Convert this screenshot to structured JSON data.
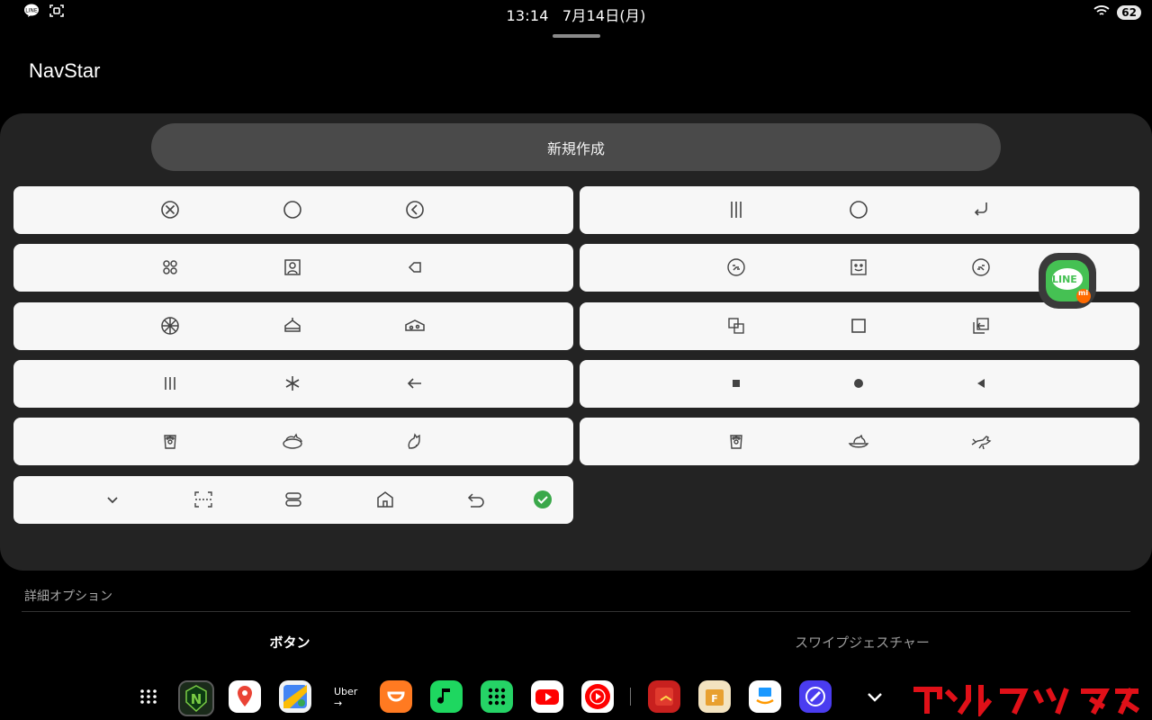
{
  "status_bar": {
    "time": "13:14",
    "date": "7月14日(月)",
    "battery": "62"
  },
  "app": {
    "title": "NavStar"
  },
  "new_button": {
    "label": "新規作成"
  },
  "styles_left": [
    {
      "icons": [
        "circle-x-icon",
        "circle-icon",
        "circle-back-icon"
      ]
    },
    {
      "icons": [
        "four-dots-icon",
        "portrait-icon",
        "arrow-tag-icon"
      ]
    },
    {
      "icons": [
        "pizza-icon",
        "cake-icon",
        "cheese-icon"
      ]
    },
    {
      "icons": [
        "three-bars-icon",
        "asterisk-icon",
        "left-arrow-icon"
      ]
    },
    {
      "icons": [
        "cat-paw-cup-icon",
        "sleeping-cat-icon",
        "sitting-cat-icon"
      ]
    }
  ],
  "styles_right": [
    {
      "icons": [
        "three-bars-icon",
        "circle-icon",
        "return-arrow-icon"
      ]
    },
    {
      "icons": [
        "face-left-icon",
        "face-square-icon",
        "face-right-icon"
      ]
    },
    {
      "icons": [
        "overlap-squares-icon",
        "square-icon",
        "square-arrow-icon"
      ]
    },
    {
      "icons": [
        "filled-square-icon",
        "filled-circle-icon",
        "filled-triangle-icon"
      ]
    },
    {
      "icons": [
        "cat-paw-cup-icon",
        "cat-bowl-icon",
        "running-cat-icon"
      ]
    }
  ],
  "custom_row": {
    "icons": [
      "chevron-down-icon",
      "scan-icon",
      "toggle-pill-icon",
      "home-icon",
      "undo-arrow-icon",
      "check-circle-icon"
    ],
    "selected_color": "#3aa84a"
  },
  "advanced_options": {
    "label": "詳細オプション"
  },
  "tabs": [
    {
      "label": "ボタン",
      "active": true
    },
    {
      "label": "スワイプジェスチャー",
      "active": false
    }
  ],
  "dock": {
    "uber_label": "Uber",
    "apps": [
      "apps-grid-icon",
      "navstar-icon",
      "maps-icon",
      "google-maps-go-icon",
      "uber-icon",
      "didi-icon",
      "music-icon",
      "dialpad-icon",
      "youtube-icon",
      "youtube-music-icon",
      "tubemate-icon",
      "file-manager-icon",
      "amazon-icon",
      "browser-icon",
      "chevron-down-icon"
    ]
  },
  "floating_bubble": {
    "label": "LINE",
    "badge": "mi"
  }
}
